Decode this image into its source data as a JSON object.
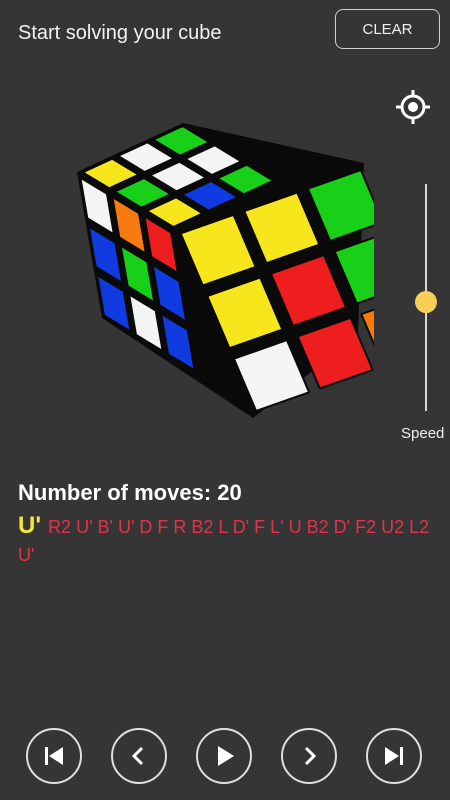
{
  "header": {
    "title": "Start solving your cube",
    "clear_label": "CLEAR"
  },
  "speed": {
    "label": "Speed",
    "value": 0.48
  },
  "moves": {
    "title": "Number of moves: 20",
    "current": "U'",
    "rest": "R2 U' B' U' D F R B2 L D' F L' U B2 D' F2 U2 L2 U'"
  },
  "colors": {
    "background": "#353535",
    "current_move": "#f3e635",
    "pending_moves": "#e3334a",
    "slider_thumb": "#f7cf57"
  },
  "cube": {
    "up": [
      [
        "green",
        "white",
        "green"
      ],
      [
        "white",
        "white",
        "blue"
      ],
      [
        "yellow",
        "green",
        "yellow"
      ]
    ],
    "left": [
      [
        "white",
        "orange",
        "red"
      ],
      [
        "blue",
        "green",
        "blue"
      ],
      [
        "blue",
        "white",
        "blue"
      ]
    ],
    "right": [
      [
        "yellow",
        "yellow",
        "green"
      ],
      [
        "yellow",
        "red",
        "green"
      ],
      [
        "white",
        "red",
        "orange"
      ]
    ]
  },
  "icons": {
    "target": "crosshair-icon",
    "first": "skip-to-start-icon",
    "prev": "chevron-left-icon",
    "play": "play-icon",
    "next": "chevron-right-icon",
    "last": "skip-to-end-icon"
  }
}
